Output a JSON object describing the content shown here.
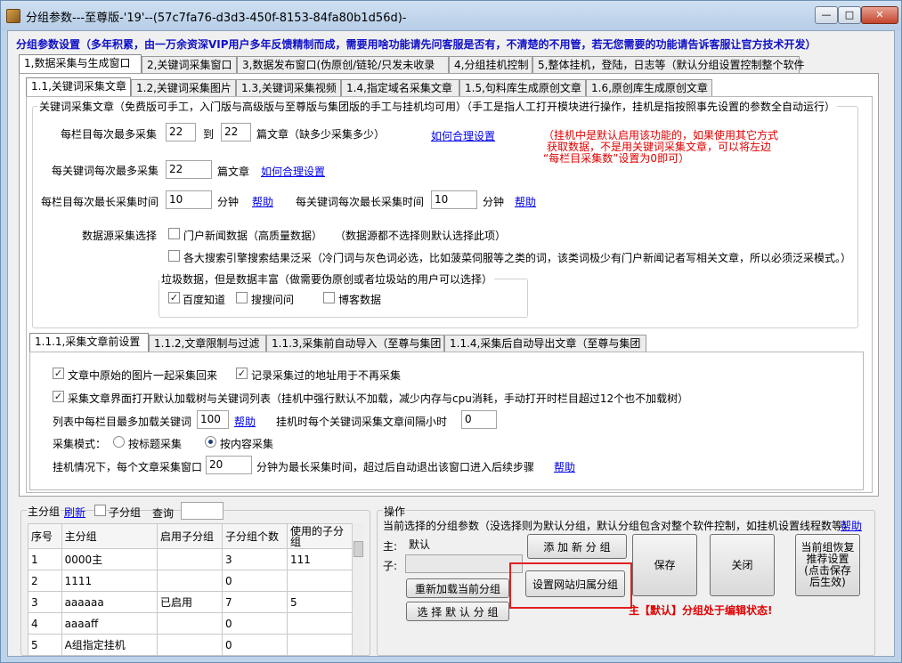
{
  "window": {
    "title": "分组参数---至尊版-'19'--(57c7fa76-d3d3-450f-8153-84fa80b1d56d)-",
    "min": "—",
    "max": "□",
    "close": "✕"
  },
  "heading": "分组参数设置（多年积累，由一万余资深VIP用户多年反馈精制而成，需要用啥功能请先问客服是否有，不清楚的不用管，若无您需要的功能请告诉客服让官方技术开发）",
  "main_tabs": [
    "1,数据采集与生成窗口",
    "2,关键词采集窗口",
    "3,数据发布窗口(伪原创/链轮/只发未收录",
    "4,分组挂机控制",
    "5,整体挂机，登陆，日志等（默认分组设置控制整个软件"
  ],
  "sub_tabs": [
    "1.1,关键词采集文章",
    "1.2,关键词采集图片",
    "1.3,关键词采集视频",
    "1.4,指定域名采集文章",
    "1.5,句料库生成原创文章",
    "1.6,原创库生成原创文章"
  ],
  "group1": {
    "title": "关键词采集文章（免费版可手工，入门版与高级版与至尊版与集团版的手工与挂机均可用）（手工是指人工打开模块进行操作，挂机是指按照事先设置的参数全自动运行）",
    "per_col_label": "每栏目每次最多采集",
    "per_col_min": "22",
    "to": "到",
    "per_col_max": "22",
    "per_col_unit": "篇文章（缺多少采集多少）",
    "howto1": "如何合理设置",
    "red_note": [
      "（挂机中是默认启用该功能的，如果使用其它方式",
      "获取数据，不是用关键词采集文章，可以将左边",
      "“每栏目采集数”设置为0即可）"
    ],
    "per_kw_label": "每关键词每次最多采集",
    "per_kw_val": "22",
    "per_kw_unit": "篇文章",
    "howto2": "如何合理设置",
    "col_time_label": "每栏目每次最长采集时间",
    "col_time_val": "10",
    "col_time_unit": "分钟",
    "help1": "帮助",
    "kw_time_label": "每关键词每次最长采集时间",
    "kw_time_val": "10",
    "kw_time_unit": "分钟",
    "help2": "帮助",
    "source_label": "数据源采集选择",
    "src_portal": "门户新闻数据（高质量数据）",
    "src_portal_note": "（数据源都不选择则默认选择此项）",
    "src_search": "各大搜索引擎搜索结果泛采（冷门词与灰色词必选，比如菠菜伺服等之类的词，该类词极少有门户新闻记者写相关文章，所以必须泛采模式。）",
    "junk_title": "垃圾数据，但是数据丰富（做需要伪原创或者垃圾站的用户可以选择）",
    "junk_baidu": "百度知道",
    "junk_sogou": "搜搜问问",
    "junk_blog": "博客数据"
  },
  "sub2_tabs": [
    "1.1.1,采集文章前设置",
    "1.1.2,文章限制与过滤",
    "1.1.3,采集前自动导入（至尊与集团",
    "1.1.4,采集后自动导出文章（至尊与集团"
  ],
  "settings": {
    "img_together": "文章中原始的图片一起采集回来",
    "record_url": "记录采集过的地址用于不再采集",
    "force_load": "采集文章界面打开默认加载树与关键词列表（挂机中强行默认不加载，减少内存与cpu消耗，手动打开时栏目超过12个也不加载树）",
    "max_kw_label": "列表中每栏目最多加载关键词",
    "max_kw_val": "100",
    "help": "帮助",
    "interval_label": "挂机时每个关键词采集文章间隔小时",
    "interval_val": "0",
    "mode_label": "采集模式：",
    "mode_title": "按标题采集",
    "mode_content": "按内容采集",
    "timeout_label": "挂机情况下，每个文章采集窗口",
    "timeout_val": "20",
    "timeout_unit": "分钟为最长采集时间，超过后自动退出该窗口进入后续步骤",
    "help2": "帮助"
  },
  "groups_panel": {
    "title": "主分组",
    "refresh": "刷新",
    "sub_label": "子分组",
    "query_label": "查询",
    "columns": [
      "序号",
      "主分组",
      "启用子分组",
      "子分组个数",
      "使用的子分组"
    ],
    "rows": [
      [
        "1",
        "0000主",
        "",
        "3",
        "111"
      ],
      [
        "2",
        "1111",
        "",
        "0",
        ""
      ],
      [
        "3",
        "aaaaaa",
        "已启用",
        "7",
        "5"
      ],
      [
        "4",
        "aaaaff",
        "",
        "0",
        ""
      ],
      [
        "5",
        "A组指定挂机",
        "",
        "0",
        ""
      ]
    ]
  },
  "ops": {
    "title": "操作",
    "desc": "当前选择的分组参数（没选择则为默认分组，默认分组包含对整个软件控制，如挂机设置线程数等）",
    "help": "帮助",
    "main_label": "主:",
    "main_val": "默认",
    "sub_label": "子:",
    "add_btn": "添 加 新 分 组",
    "reload_btn": "重新加载当前分组",
    "select_btn": "选 择 默 认 分 组",
    "site_btn": "设置网站归属分组",
    "save_btn": "保存",
    "close_btn": "关闭",
    "restore_btn": [
      "当前组恢复",
      "推荐设置",
      "(点击保存",
      "后生效)"
    ],
    "status": "主【默认】分组处于编辑状态!"
  }
}
